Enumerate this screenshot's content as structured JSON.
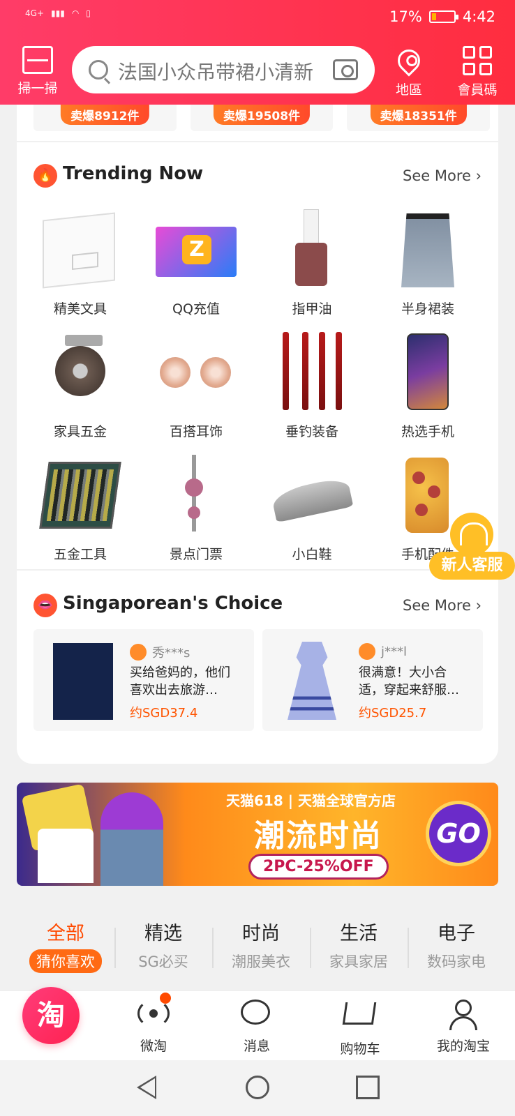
{
  "status": {
    "network": "4G+",
    "battery": "17%",
    "time": "4:42"
  },
  "header": {
    "scan_label": "掃一掃",
    "search_placeholder": "法国小众吊带裙小清新",
    "map_label": "地區",
    "member_label": "會員碼"
  },
  "previous_row": {
    "pills": [
      "卖爆8912件",
      "卖爆19508件",
      "卖爆18351件"
    ]
  },
  "trending": {
    "title": "Trending Now",
    "more": "See More",
    "items": [
      {
        "label": "精美文具",
        "icon": "binder"
      },
      {
        "label": "QQ充值",
        "icon": "qq-diamond"
      },
      {
        "label": "指甲油",
        "icon": "nail-polish"
      },
      {
        "label": "半身裙装",
        "icon": "denim-skirt"
      },
      {
        "label": "家具五金",
        "icon": "caster-wheel"
      },
      {
        "label": "百搭耳饰",
        "icon": "earrings"
      },
      {
        "label": "垂钓装备",
        "icon": "fishing-rods"
      },
      {
        "label": "热选手机",
        "icon": "smartphone"
      },
      {
        "label": "五金工具",
        "icon": "tool-case"
      },
      {
        "label": "景点门票",
        "icon": "tv-tower"
      },
      {
        "label": "小白鞋",
        "icon": "sneaker"
      },
      {
        "label": "手机配件",
        "icon": "phone-case"
      }
    ]
  },
  "choice": {
    "title": "Singaporean's Choice",
    "more": "See More",
    "cards": [
      {
        "user": "秀***s",
        "text": "买给爸妈的，他们喜欢出去旅游…",
        "price": "约SGD37.4"
      },
      {
        "user": "j***l",
        "text": "很满意！大小合适，穿起来舒服…",
        "price": "约SGD25.7"
      }
    ]
  },
  "banner": {
    "brand": "天猫618 | 天猫全球官方店",
    "headline": "潮流时尚",
    "deal": "2PC-25%OFF",
    "go": "GO"
  },
  "tabs": [
    {
      "title": "全部",
      "sub": "猜你喜欢",
      "active": true
    },
    {
      "title": "精选",
      "sub": "SG必买"
    },
    {
      "title": "时尚",
      "sub": "潮服美衣"
    },
    {
      "title": "生活",
      "sub": "家具家居"
    },
    {
      "title": "电子",
      "sub": "数码家电"
    }
  ],
  "service": {
    "label": "新人客服"
  },
  "nav": {
    "logo": "淘",
    "items": [
      {
        "label": "微淘"
      },
      {
        "label": "消息"
      },
      {
        "label": "购物车"
      },
      {
        "label": "我的淘宝"
      }
    ]
  },
  "colors": {
    "header": "#ff2d4f",
    "accent": "#ff5400",
    "service": "#ffbf26"
  }
}
